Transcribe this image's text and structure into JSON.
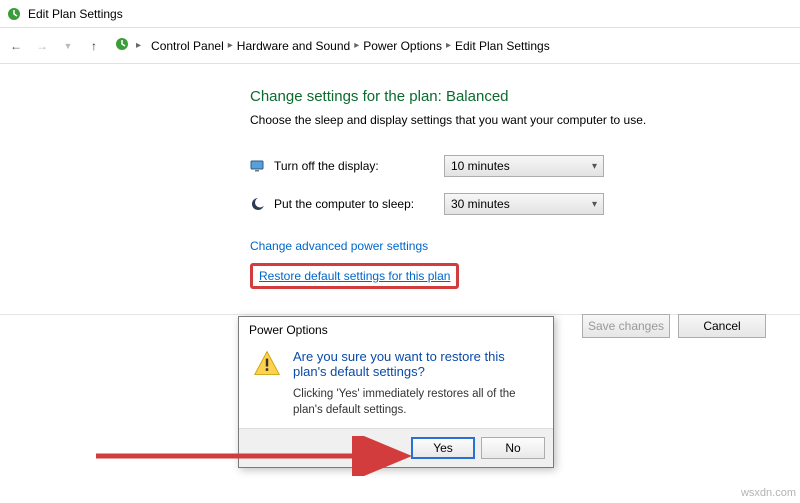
{
  "window": {
    "title": "Edit Plan Settings"
  },
  "breadcrumbs": {
    "items": [
      "Control Panel",
      "Hardware and Sound",
      "Power Options",
      "Edit Plan Settings"
    ]
  },
  "main": {
    "heading": "Change settings for the plan: Balanced",
    "subheading": "Choose the sleep and display settings that you want your computer to use.",
    "display_off": {
      "label": "Turn off the display:",
      "value": "10 minutes"
    },
    "sleep": {
      "label": "Put the computer to sleep:",
      "value": "30 minutes"
    },
    "advanced_link": "Change advanced power settings",
    "restore_link": "Restore default settings for this plan"
  },
  "buttons": {
    "save": "Save changes",
    "cancel": "Cancel"
  },
  "dialog": {
    "title": "Power Options",
    "heading": "Are you sure you want to restore this plan's default settings?",
    "body": "Clicking 'Yes' immediately restores all of the plan's default settings.",
    "yes": "Yes",
    "no": "No"
  },
  "watermark": "wsxdn.com"
}
